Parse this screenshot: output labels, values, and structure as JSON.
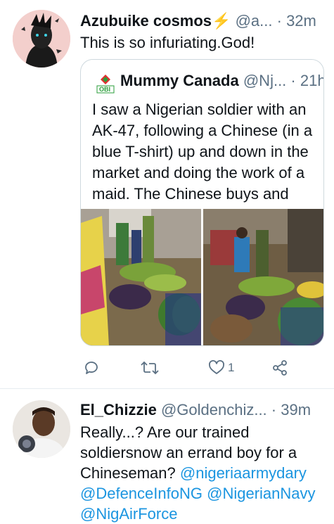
{
  "tweets": [
    {
      "author_name": "Azubuike cosmos",
      "author_emoji": "⚡",
      "handle": "@a...",
      "separator": "·",
      "time": "32m",
      "text": "This is so infuriating.God!",
      "quote": {
        "author_name": "Mummy Canada",
        "handle": "@Nj...",
        "separator": "·",
        "time": "21h",
        "logo_text": "OBI",
        "text": "I saw a Nigerian soldier with an AK-47, following a Chinese (in a blue T-shirt) up and down in the market and doing the work of a maid. The Chinese buys and gi..."
      },
      "actions": {
        "reply_icon": "reply-icon",
        "retweet_icon": "retweet-icon",
        "like_icon": "heart-icon",
        "like_count": "1",
        "share_icon": "share-icon"
      }
    },
    {
      "author_name": "El_Chizzie",
      "handle": "@Goldenchiz...",
      "separator": "·",
      "time": "39m",
      "text_lines": [
        "Really...? Are our trained",
        "soldiersnow an errand boy for a",
        "Chineseman?"
      ],
      "mentions": [
        "@nigeriaarmydary",
        "@DefenceInfoNG",
        "@NigerianNavy",
        "@NigAirForce"
      ]
    }
  ],
  "colors": {
    "text": "#0f1419",
    "muted": "#5b7083",
    "link": "#1b95e0",
    "border": "#cfd9de"
  }
}
